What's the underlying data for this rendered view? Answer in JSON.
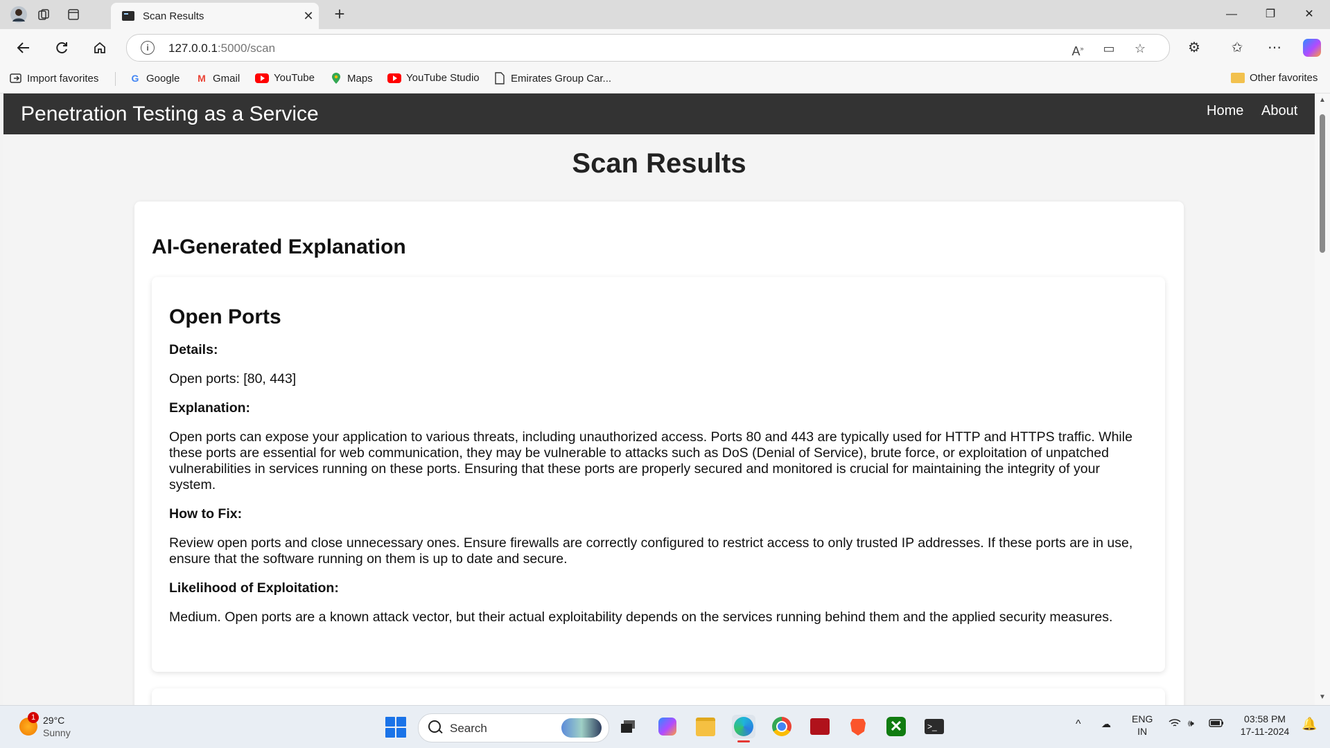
{
  "browser": {
    "tab_title": "Scan Results",
    "url_host": "127.0.0.1",
    "url_path": ":5000/scan",
    "bookmarks": [
      {
        "label": "Import favorites",
        "icon": "import-icon"
      },
      {
        "label": "Google",
        "icon": "google-icon"
      },
      {
        "label": "Gmail",
        "icon": "gmail-icon"
      },
      {
        "label": "YouTube",
        "icon": "youtube-icon"
      },
      {
        "label": "Maps",
        "icon": "maps-icon"
      },
      {
        "label": "YouTube Studio",
        "icon": "youtube-studio-icon"
      },
      {
        "label": "Emirates Group Car...",
        "icon": "page-icon"
      }
    ],
    "other_favorites": "Other favorites"
  },
  "site": {
    "title": "Penetration Testing as a Service",
    "nav": [
      "Home",
      "About"
    ]
  },
  "page": {
    "heading": "Scan Results",
    "section_heading": "AI-Generated Explanation",
    "cards": [
      {
        "title": "Open Ports",
        "details_label": "Details:",
        "details": "Open ports: [80, 443]",
        "explanation_label": "Explanation:",
        "explanation": "Open ports can expose your application to various threats, including unauthorized access. Ports 80 and 443 are typically used for HTTP and HTTPS traffic. While these ports are essential for web communication, they may be vulnerable to attacks such as DoS (Denial of Service), brute force, or exploitation of unpatched vulnerabilities in services running on these ports. Ensuring that these ports are properly secured and monitored is crucial for maintaining the integrity of your system.",
        "fix_label": "How to Fix:",
        "fix": "Review open ports and close unnecessary ones. Ensure firewalls are correctly configured to restrict access to only trusted IP addresses. If these ports are in use, ensure that the software running on them is up to date and secure.",
        "likelihood_label": "Likelihood of Exploitation:",
        "likelihood": "Medium. Open ports are a known attack vector, but their actual exploitability depends on the services running behind them and the applied security measures."
      }
    ]
  },
  "taskbar": {
    "weather_temp": "29°C",
    "weather_desc": "Sunny",
    "weather_badge": "1",
    "search_label": "Search",
    "lang_top": "ENG",
    "lang_bottom": "IN",
    "time": "03:58 PM",
    "date": "17-11-2024"
  },
  "colors": {
    "site_header": "#333333",
    "page_bg": "#f4f4f4",
    "card_bg": "#ffffff"
  }
}
